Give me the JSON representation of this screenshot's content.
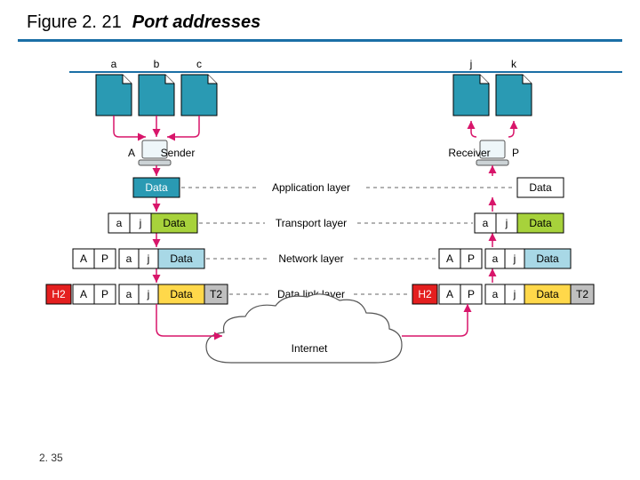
{
  "title": {
    "fig_no": "Figure 2. 21",
    "fig_name": "Port addresses"
  },
  "page_no": "2. 35",
  "processes": {
    "left": [
      "a",
      "b",
      "c"
    ],
    "right": [
      "j",
      "k"
    ]
  },
  "hosts": {
    "left_label": "A",
    "left_role": "Sender",
    "right_label": "P",
    "right_role": "Receiver"
  },
  "layers": {
    "application": "Application layer",
    "transport": "Transport layer",
    "network": "Network layer",
    "datalink": "Data link layer"
  },
  "segments": {
    "app": {
      "left": [
        "Data"
      ],
      "right": [
        "Data"
      ]
    },
    "trans": {
      "left": [
        "a",
        "j",
        "Data"
      ],
      "right": [
        "a",
        "j",
        "Data"
      ]
    },
    "net": {
      "left": [
        "A",
        "P",
        "a",
        "j",
        "Data"
      ],
      "right": [
        "A",
        "P",
        "a",
        "j",
        "Data"
      ]
    },
    "link": {
      "left": [
        "H2",
        "A",
        "P",
        "a",
        "j",
        "Data",
        "T2"
      ],
      "right": [
        "H2",
        "A",
        "P",
        "a",
        "j",
        "Data",
        "T2"
      ]
    }
  },
  "cloud": "Internet",
  "colors": {
    "teal": "#2a9ab3",
    "white": "#ffffff",
    "green": "#a7d23b",
    "blue": "#a8d8e6",
    "yellow": "#ffd84a",
    "red": "#e41f1f",
    "grey": "#bfbfbf",
    "arrow": "#d8156a"
  }
}
